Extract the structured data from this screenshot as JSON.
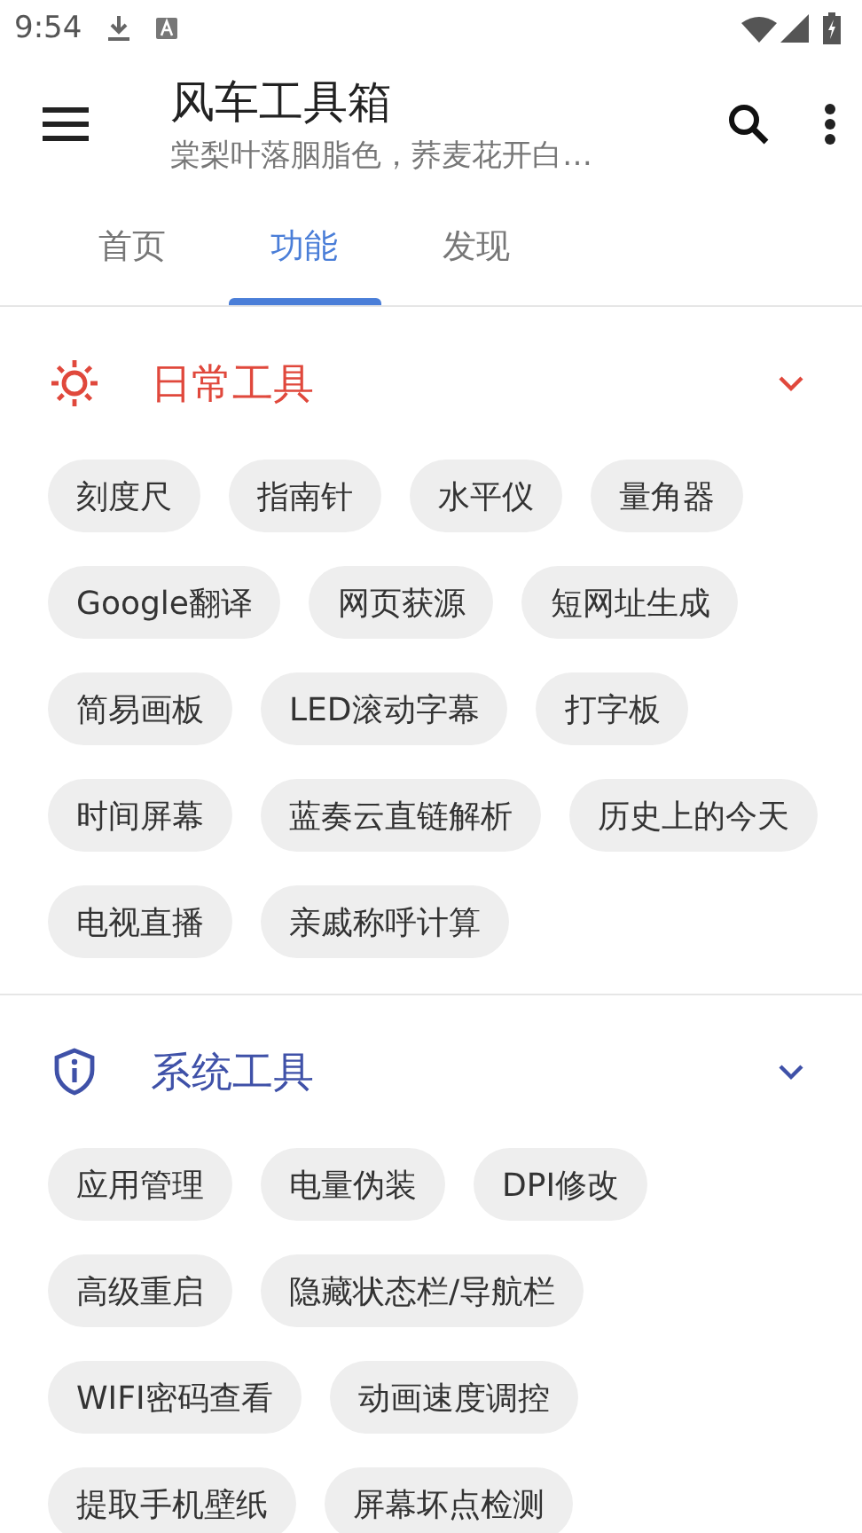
{
  "status_bar": {
    "time": "9:54"
  },
  "app_bar": {
    "title": "风车工具箱",
    "subtitle": "棠梨叶落胭脂色，荞麦花开白…"
  },
  "tabs": [
    {
      "label": "首页",
      "selected": false
    },
    {
      "label": "功能",
      "selected": true
    },
    {
      "label": "发现",
      "selected": false
    }
  ],
  "sections": [
    {
      "title": "日常工具",
      "kind": "sun",
      "color": "#e0483c",
      "expanded": true,
      "tools": [
        "刻度尺",
        "指南针",
        "水平仪",
        "量角器",
        "Google翻译",
        "网页获源",
        "短网址生成",
        "简易画板",
        "LED滚动字幕",
        "打字板",
        "时间屏幕",
        "蓝奏云直链解析",
        "历史上的今天",
        "电视直播",
        "亲戚称呼计算"
      ]
    },
    {
      "title": "系统工具",
      "kind": "shield",
      "color": "#3f51a8",
      "expanded": true,
      "tools": [
        "应用管理",
        "电量伪装",
        "DPI修改",
        "高级重启",
        "隐藏状态栏/导航栏",
        "WIFI密码查看",
        "动画速度调控",
        "提取手机壁纸",
        "屏幕坏点检测"
      ]
    }
  ]
}
